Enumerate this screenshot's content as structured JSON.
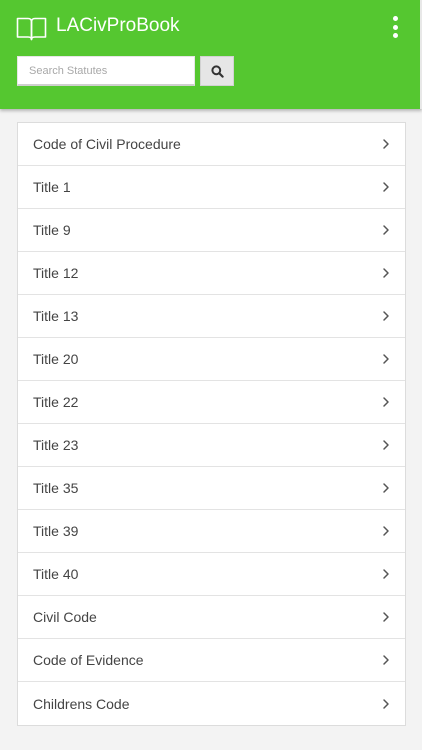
{
  "app": {
    "title": "LACivProBook",
    "brand_color": "#55c730",
    "logo_icon": "open-book-icon",
    "menu_icon": "more-vertical-icon"
  },
  "search": {
    "placeholder": "Search Statutes",
    "value": "",
    "button_icon": "search-icon"
  },
  "list": {
    "chevron_icon": "chevron-right-icon",
    "items": [
      {
        "label": "Code of Civil Procedure"
      },
      {
        "label": "Title 1"
      },
      {
        "label": "Title 9"
      },
      {
        "label": "Title 12"
      },
      {
        "label": "Title 13"
      },
      {
        "label": "Title 20"
      },
      {
        "label": "Title 22"
      },
      {
        "label": "Title 23"
      },
      {
        "label": "Title 35"
      },
      {
        "label": "Title 39"
      },
      {
        "label": "Title 40"
      },
      {
        "label": "Civil Code"
      },
      {
        "label": "Code of Evidence"
      },
      {
        "label": "Childrens Code"
      }
    ]
  }
}
